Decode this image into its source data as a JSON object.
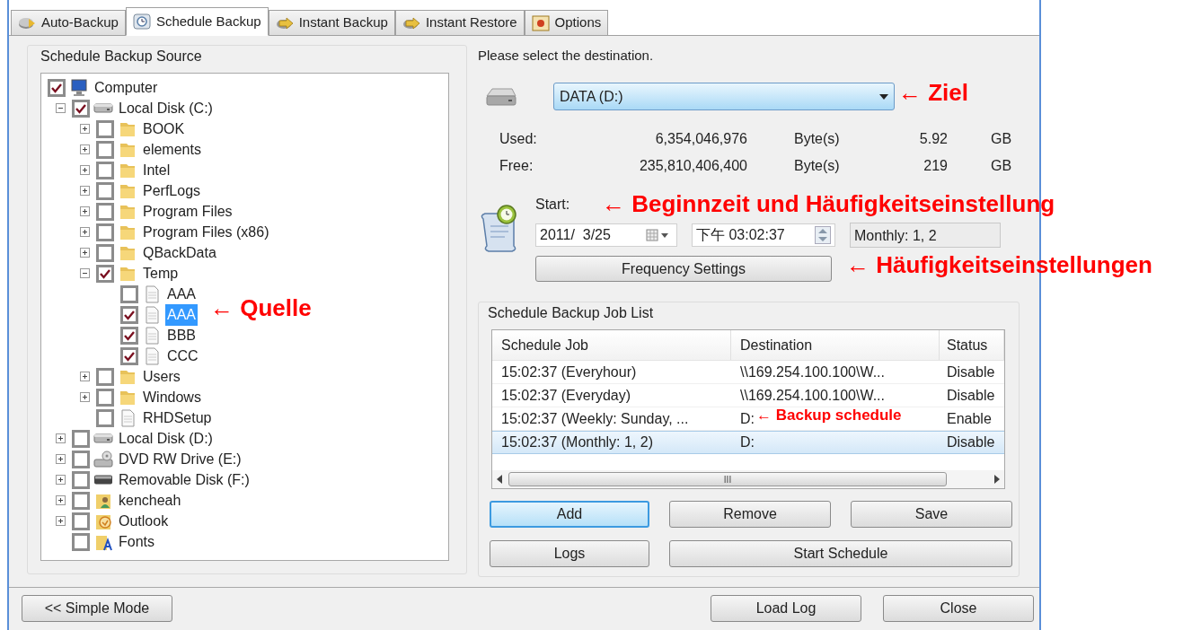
{
  "tabs": [
    {
      "label": "Auto-Backup",
      "kind": "disks",
      "selected": false
    },
    {
      "label": "Schedule Backup",
      "kind": "clock",
      "selected": true
    },
    {
      "label": "Instant Backup",
      "kind": "arrow",
      "selected": false
    },
    {
      "label": "Instant Restore",
      "kind": "arrow",
      "selected": false
    },
    {
      "label": "Options",
      "kind": "options",
      "selected": false
    }
  ],
  "source": {
    "title": "Schedule Backup Source",
    "tree": [
      {
        "label": "Computer",
        "kind": "computer",
        "checked": true,
        "selected": false,
        "children": [
          {
            "label": "Local Disk (C:)",
            "kind": "drive",
            "checked": true,
            "selected": false,
            "expanded": true,
            "children": [
              {
                "label": "BOOK",
                "kind": "folder",
                "checked": false,
                "selected": false,
                "expanded": false
              },
              {
                "label": "elements",
                "kind": "folder",
                "checked": false,
                "selected": false,
                "expanded": false
              },
              {
                "label": "Intel",
                "kind": "folder",
                "checked": false,
                "selected": false,
                "expanded": false
              },
              {
                "label": "PerfLogs",
                "kind": "folder",
                "checked": false,
                "selected": false,
                "expanded": false
              },
              {
                "label": "Program Files",
                "kind": "folder",
                "checked": false,
                "selected": false,
                "expanded": false
              },
              {
                "label": "Program Files (x86)",
                "kind": "folder",
                "checked": false,
                "selected": false,
                "expanded": false
              },
              {
                "label": "QBackData",
                "kind": "folder",
                "checked": false,
                "selected": false,
                "expanded": false
              },
              {
                "label": "Temp",
                "kind": "folder",
                "checked": true,
                "selected": false,
                "expanded": true,
                "children": [
                  {
                    "label": "AAA",
                    "kind": "file",
                    "checked": false,
                    "selected": false
                  },
                  {
                    "label": "AAA",
                    "kind": "file",
                    "checked": true,
                    "selected": true
                  },
                  {
                    "label": "BBB",
                    "kind": "file",
                    "checked": true,
                    "selected": false
                  },
                  {
                    "label": "CCC",
                    "kind": "file",
                    "checked": true,
                    "selected": false
                  }
                ]
              },
              {
                "label": "Users",
                "kind": "folder",
                "checked": false,
                "selected": false,
                "expanded": false
              },
              {
                "label": "Windows",
                "kind": "folder",
                "checked": false,
                "selected": false,
                "expanded": false
              },
              {
                "label": "RHDSetup",
                "kind": "file",
                "checked": false,
                "selected": false
              }
            ]
          },
          {
            "label": "Local Disk (D:)",
            "kind": "drive",
            "checked": false,
            "selected": false,
            "expanded": false
          },
          {
            "label": "DVD RW Drive (E:)",
            "kind": "dvd",
            "checked": false,
            "selected": false,
            "expanded": false
          },
          {
            "label": "Removable Disk (F:)",
            "kind": "removable",
            "checked": false,
            "selected": false,
            "expanded": false
          },
          {
            "label": "kencheah",
            "kind": "user",
            "checked": false,
            "selected": false,
            "expanded": false
          },
          {
            "label": "Outlook",
            "kind": "outlook",
            "checked": false,
            "selected": false,
            "expanded": false
          },
          {
            "label": "Fonts",
            "kind": "fonts",
            "checked": false,
            "selected": false
          }
        ]
      }
    ]
  },
  "destination": {
    "prompt": "Please select the destination.",
    "drive": "DATA (D:)",
    "stats": [
      {
        "label": "Used:",
        "bytes": "6,354,046,976",
        "unit": "Byte(s)",
        "size": "5.92",
        "size_unit": "GB"
      },
      {
        "label": "Free:",
        "bytes": "235,810,406,400",
        "unit": "Byte(s)",
        "size": "219",
        "size_unit": "GB"
      }
    ]
  },
  "schedule": {
    "start_label": "Start:",
    "date": "2011/  3/25",
    "time": "下午 03:02:37",
    "frequency": "Monthly: 1, 2",
    "frequency_button": "Frequency Settings"
  },
  "job_list": {
    "title": "Schedule Backup Job List",
    "columns": [
      "Schedule Job",
      "Destination",
      "Status"
    ],
    "rows": [
      {
        "cells": [
          "15:02:37 (Everyhour)",
          "\\\\169.254.100.100\\W...",
          "Disable"
        ],
        "selected": false
      },
      {
        "cells": [
          "15:02:37 (Everyday)",
          "\\\\169.254.100.100\\W...",
          "Disable"
        ],
        "selected": false
      },
      {
        "cells": [
          "15:02:37 (Weekly: Sunday, ...",
          "D:",
          "Enable"
        ],
        "selected": false
      },
      {
        "cells": [
          "15:02:37 (Monthly: 1, 2)",
          "D:",
          "Disable"
        ],
        "selected": true
      }
    ],
    "scroll_grip": "III",
    "buttons": [
      {
        "label": "Add",
        "selected": true
      },
      {
        "label": "Remove",
        "selected": false
      },
      {
        "label": "Save",
        "selected": false
      },
      {
        "label": "Logs",
        "selected": false
      },
      {
        "label": "Start Schedule",
        "selected": false
      }
    ]
  },
  "footer": {
    "buttons": [
      "<< Simple Mode",
      "Load Log",
      "Close"
    ]
  },
  "annotations": [
    "← Ziel",
    "← Beginnzeit und Häufigkeitseinstellung",
    "← Häufigkeitseinstellungen",
    "← Quelle",
    "← Backup schedule"
  ]
}
